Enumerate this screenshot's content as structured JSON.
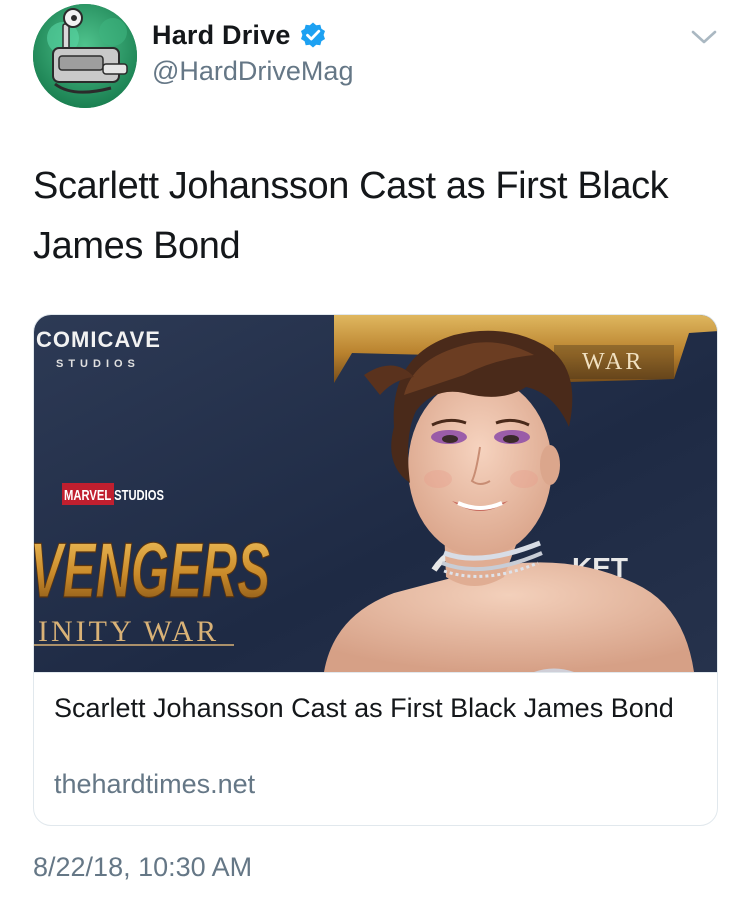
{
  "user": {
    "display_name": "Hard Drive",
    "handle": "@HardDriveMag",
    "verified": true,
    "avatar_icon": "robot-mascot-avatar"
  },
  "tweet": {
    "text": "Scarlett Johansson Cast as First Black James Bond",
    "timestamp": "8/22/18, 10:30 AM"
  },
  "card": {
    "title": "Scarlett Johansson Cast as First Black James Bond",
    "domain": "thehardtimes.net",
    "image": {
      "comicave_brand": "COMICAVE",
      "comicave_sub": "STUDIOS",
      "marvel_text": "MARVEL STUDIOS",
      "avengers_text": "VENGERS",
      "infinity_war_text": "INITY WAR",
      "top_war_text": "WAR",
      "ticket_text": "KET"
    }
  },
  "icons": {
    "verified": "verified-badge-icon",
    "menu": "chevron-down-icon"
  },
  "colors": {
    "verified_blue": "#1da1f2",
    "secondary_text": "#657786",
    "border": "#e1e8ed"
  }
}
